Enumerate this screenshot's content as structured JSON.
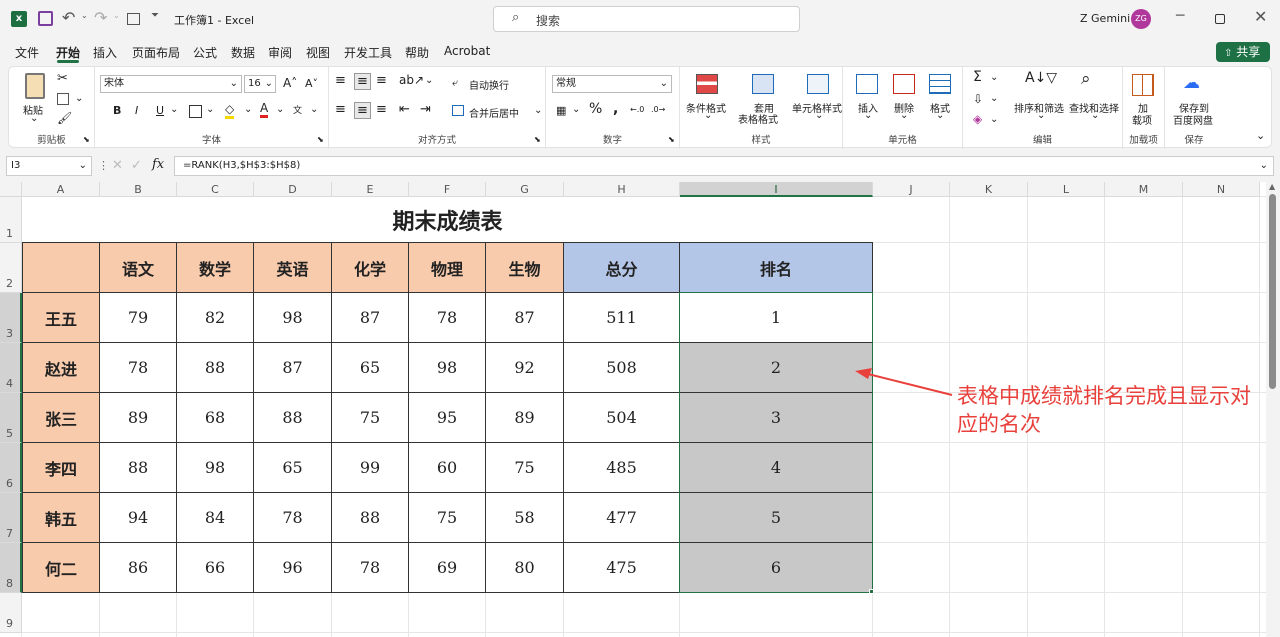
{
  "app": {
    "file_title": "工作簿1 - Excel",
    "search_placeholder": "搜索",
    "user_name": "Z Gemini",
    "user_initials": "ZG",
    "share_label": "共享"
  },
  "colors": {
    "accent": "#217346",
    "peach": "#f8cbad",
    "blue": "#b4c6e7",
    "gray": "#c8c8c8",
    "arrow": "#e8413c",
    "avatar": "#b0379c"
  },
  "menu": [
    "文件",
    "开始",
    "插入",
    "页面布局",
    "公式",
    "数据",
    "审阅",
    "视图",
    "开发工具",
    "帮助",
    "Acrobat"
  ],
  "ribbon": {
    "clipboard": {
      "paste": "粘贴",
      "label": "剪贴板"
    },
    "font": {
      "name": "宋体",
      "size": "16",
      "bold": "B",
      "italic": "I",
      "underline": "U",
      "label": "字体"
    },
    "alignment": {
      "wrap": "自动换行",
      "merge": "合并后居中",
      "label": "对齐方式"
    },
    "number": {
      "format": "常规",
      "label": "数字"
    },
    "styles": {
      "cond": "条件格式",
      "table1": "套用",
      "table2": "表格格式",
      "cellstyle": "单元格样式",
      "label": "样式"
    },
    "cells": {
      "insert": "插入",
      "delete": "删除",
      "format": "格式",
      "label": "单元格"
    },
    "editing": {
      "sortfilter": "排序和筛选",
      "findselect": "查找和选择",
      "label": "编辑"
    },
    "addins": {
      "btn1": "加",
      "btn2": "载项",
      "label": "加载项"
    },
    "save": {
      "btn1": "保存到",
      "btn2": "百度网盘",
      "label": "保存"
    }
  },
  "formula_bar": {
    "namebox": "I3",
    "formula": "=RANK(H3,$H$3:$H$8)"
  },
  "columns": [
    "A",
    "B",
    "C",
    "D",
    "E",
    "F",
    "G",
    "H",
    "I",
    "J",
    "K",
    "L",
    "M",
    "N"
  ],
  "rows": [
    "1",
    "2",
    "3",
    "4",
    "5",
    "6",
    "7",
    "8",
    "9"
  ],
  "sheet": {
    "title": "期末成绩表",
    "headers": [
      "",
      "语文",
      "数学",
      "英语",
      "化学",
      "物理",
      "生物",
      "总分",
      "排名"
    ],
    "data": [
      [
        "王五",
        "79",
        "82",
        "98",
        "87",
        "78",
        "87",
        "511",
        "1"
      ],
      [
        "赵进",
        "78",
        "88",
        "87",
        "65",
        "98",
        "92",
        "508",
        "2"
      ],
      [
        "张三",
        "89",
        "68",
        "88",
        "75",
        "95",
        "89",
        "504",
        "3"
      ],
      [
        "李四",
        "88",
        "98",
        "65",
        "99",
        "60",
        "75",
        "485",
        "4"
      ],
      [
        "韩五",
        "94",
        "84",
        "78",
        "88",
        "75",
        "58",
        "477",
        "5"
      ],
      [
        "何二",
        "86",
        "66",
        "96",
        "78",
        "69",
        "80",
        "475",
        "6"
      ]
    ]
  },
  "annotation": {
    "line1": "表格中成绩就排名完成且显示对",
    "line2": "应的名次"
  }
}
